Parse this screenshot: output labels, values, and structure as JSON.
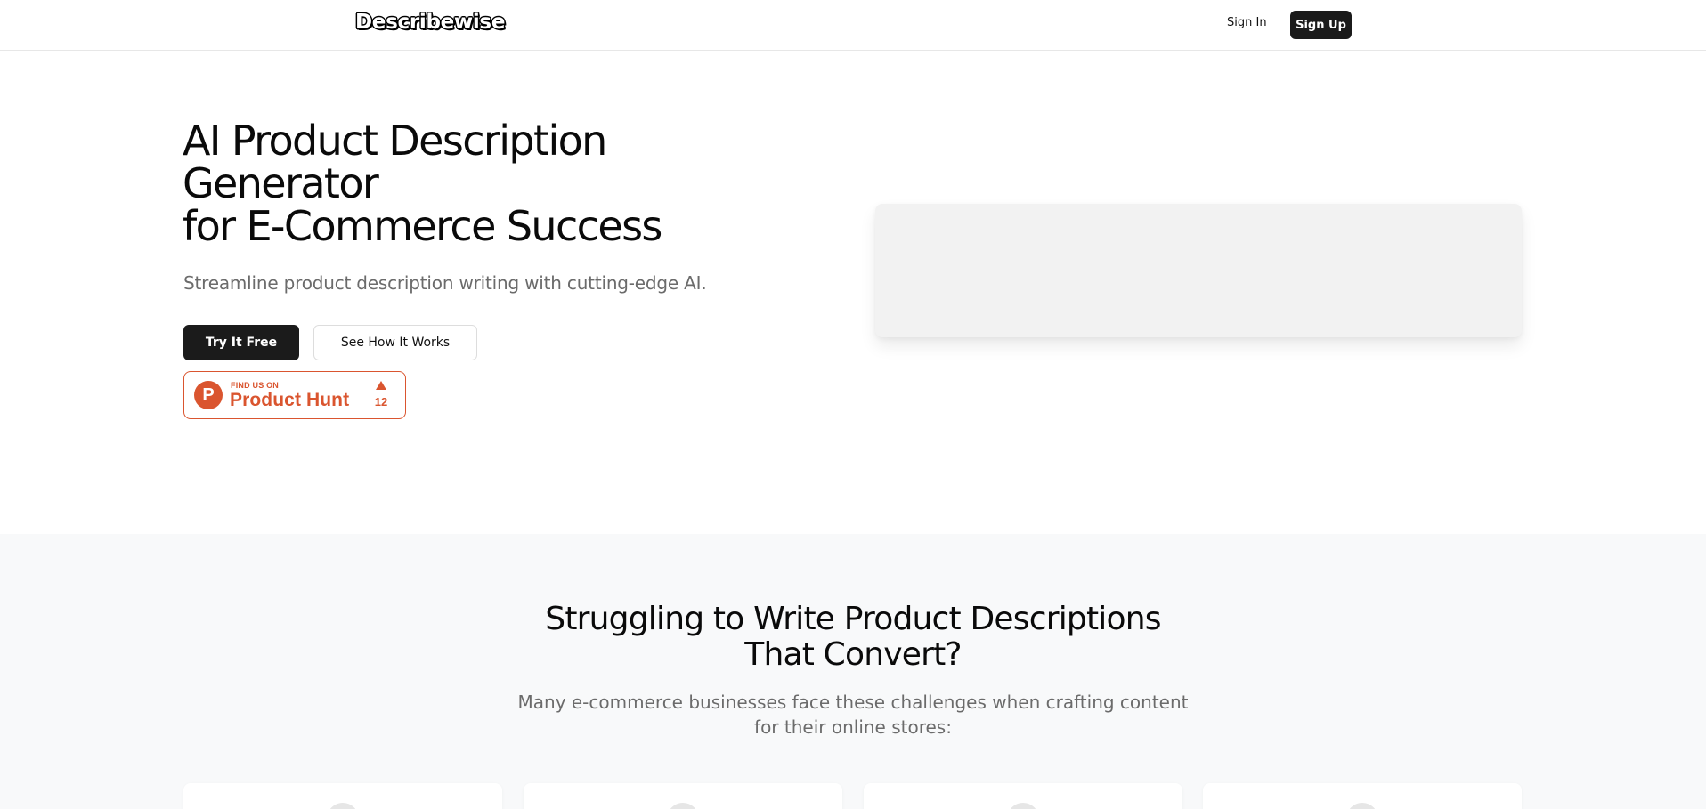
{
  "header": {
    "logo": "Describewise",
    "signin_label": "Sign In",
    "signup_label": "Sign Up"
  },
  "hero": {
    "title_lines": [
      "AI Product Description",
      "Generator",
      "for E-Commerce Success"
    ],
    "subtitle": "Streamline product description writing with cutting-edge AI.",
    "primary_button": "Try It Free",
    "secondary_button": "See How It Works",
    "product_hunt": {
      "find_us": "FIND US ON",
      "name": "Product Hunt",
      "logo_letter": "P",
      "upvotes": "12"
    }
  },
  "problem_section": {
    "title_lines": [
      "Struggling to Write Product Descriptions",
      "That Convert?"
    ],
    "subtitle_lines": [
      "Many e-commerce businesses face these challenges when crafting content",
      "for their online stores:"
    ]
  },
  "colors": {
    "primary_dark": "#1b1b1b",
    "product_hunt": "#da552f",
    "muted_text": "#6b6b6b",
    "section_bg": "#f8f9fa"
  }
}
